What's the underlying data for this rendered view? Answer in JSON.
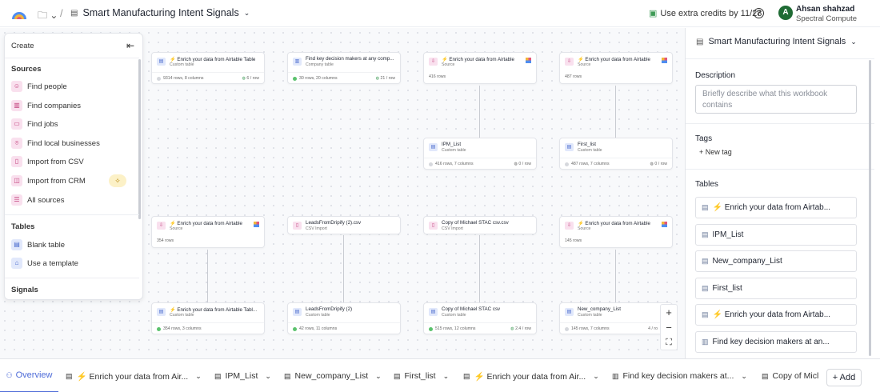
{
  "header": {
    "workbook_title": "Smart Manufacturing Intent Signals",
    "credits": "Use extra credits by 11/28",
    "user_initial": "A",
    "user_name": "Ahsan shahzad",
    "user_org": "Spectral Compute"
  },
  "left_panel": {
    "create_label": "Create",
    "sources_heading": "Sources",
    "sources": [
      {
        "label": "Find people",
        "icon": "person-icon"
      },
      {
        "label": "Find companies",
        "icon": "building-icon"
      },
      {
        "label": "Find jobs",
        "icon": "briefcase-icon"
      },
      {
        "label": "Find local businesses",
        "icon": "map-pin-icon"
      },
      {
        "label": "Import from CSV",
        "icon": "csv-icon"
      },
      {
        "label": "Import from CRM",
        "icon": "crm-icon"
      },
      {
        "label": "All sources",
        "icon": "list-icon"
      }
    ],
    "tables_heading": "Tables",
    "tables": [
      {
        "label": "Blank table",
        "icon": "table-icon"
      },
      {
        "label": "Use a template",
        "icon": "template-icon"
      }
    ],
    "signals_heading": "Signals"
  },
  "nodes": {
    "n1": {
      "title": "⚡ Enrich your data from Airtable Table",
      "sub": "Custom table",
      "stats": "9314 rows, 8 columns",
      "rate": "6 / row"
    },
    "n2": {
      "title": "Find key decision makers at any comp...",
      "sub": "Company table",
      "stats": "30 rows, 20 columns",
      "rate": "21 / row"
    },
    "n3": {
      "title": "⚡ Enrich your data from Airtable",
      "sub": "Source",
      "stats": "416 rows"
    },
    "n4": {
      "title": "⚡ Enrich your data from Airtable",
      "sub": "Source",
      "stats": "487 rows"
    },
    "n5": {
      "title": "IPM_List",
      "sub": "Custom table",
      "stats": "416 rows, 7 columns",
      "rate": "0 / row"
    },
    "n6": {
      "title": "First_list",
      "sub": "Custom table",
      "stats": "487 rows, 7 columns",
      "rate": "0 / row"
    },
    "n7": {
      "title": "⚡ Enrich your data from Airtable",
      "sub": "Source",
      "stats": "354 rows"
    },
    "n8": {
      "title": "LeadsFromDripify (2).csv",
      "sub": "CSV Import"
    },
    "n9": {
      "title": "Copy of Michael STAC csv.csv",
      "sub": "CSV Import"
    },
    "n10": {
      "title": "⚡ Enrich your data from Airtable",
      "sub": "Source",
      "stats": "145 rows"
    },
    "n11": {
      "title": "⚡ Enrich your data from Airtable Tabl...",
      "sub": "Custom table",
      "stats": "354 rows, 3 columns"
    },
    "n12": {
      "title": "LeadsFromDripify (2)",
      "sub": "Custom table",
      "stats": "42 rows, 11 columns"
    },
    "n13": {
      "title": "Copy of Michael STAC csv",
      "sub": "Custom table",
      "stats": "515 rows, 12 columns",
      "rate": "2.4 / row"
    },
    "n14": {
      "title": "New_company_List",
      "sub": "Custom table",
      "stats": "145 rows, 7 columns",
      "rate": "4 / ro"
    }
  },
  "zoom": {
    "in": "+",
    "out": "−",
    "fit": "⛶"
  },
  "right_panel": {
    "title": "Smart Manufacturing Intent Signals",
    "description_label": "Description",
    "description_placeholder": "Briefly describe what this workbook contains",
    "tags_label": "Tags",
    "new_tag": "+ New tag",
    "tables_label": "Tables",
    "tables": [
      "⚡ Enrich your data from Airtab...",
      "IPM_List",
      "New_company_List",
      "First_list",
      "⚡ Enrich your data from Airtab...",
      "Find key decision makers at an..."
    ]
  },
  "bottom_tabs": {
    "overview": "Overview",
    "tabs": [
      "⚡ Enrich your data from Air...",
      "IPM_List",
      "New_company_List",
      "First_list",
      "⚡ Enrich your data from Air...",
      "Find key decision makers at...",
      "Copy of Micl"
    ],
    "add": "Add"
  }
}
